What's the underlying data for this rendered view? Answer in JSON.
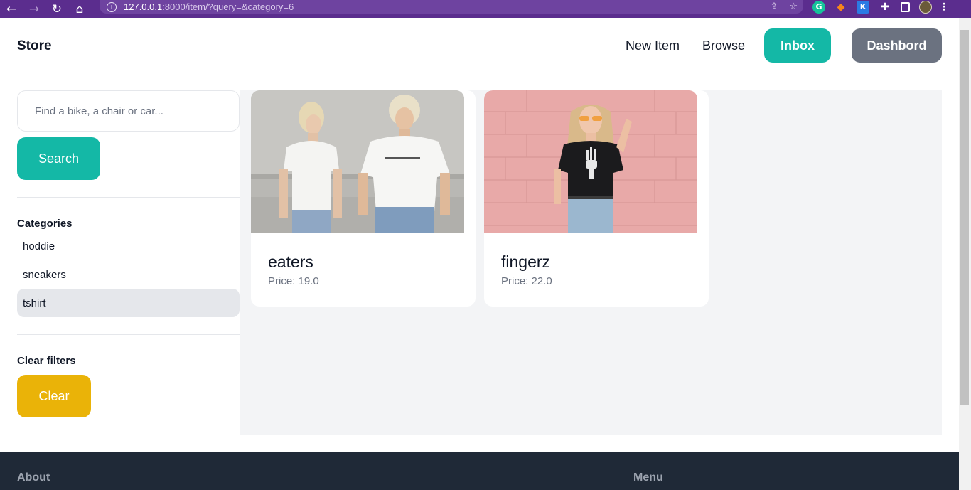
{
  "browser": {
    "url_host": "127.0.0.1",
    "url_path": ":8000/item/?query=&category=6"
  },
  "header": {
    "brand": "Store",
    "nav": {
      "new_item": "New Item",
      "browse": "Browse",
      "inbox": "Inbox",
      "dashboard": "Dashbord"
    }
  },
  "sidebar": {
    "search_placeholder": "Find a bike, a chair or car...",
    "search_button": "Search",
    "categories_title": "Categories",
    "categories": [
      {
        "label": "hoddie",
        "selected": false
      },
      {
        "label": "sneakers",
        "selected": false
      },
      {
        "label": "tshirt",
        "selected": true
      }
    ],
    "clear_title": "Clear filters",
    "clear_button": "Clear"
  },
  "items": [
    {
      "name": "eaters",
      "price": "Price: 19.0",
      "image": "two people in white t-shirts"
    },
    {
      "name": "fingerz",
      "price": "Price: 22.0",
      "image": "woman in black skeleton-hand t-shirt"
    }
  ],
  "footer": {
    "about": "About",
    "menu": "Menu"
  },
  "colors": {
    "accent": "#14b8a6",
    "secondary": "#6b7280",
    "clear": "#eab308",
    "footer": "#1f2937",
    "chrome": "#5b2d8e"
  }
}
